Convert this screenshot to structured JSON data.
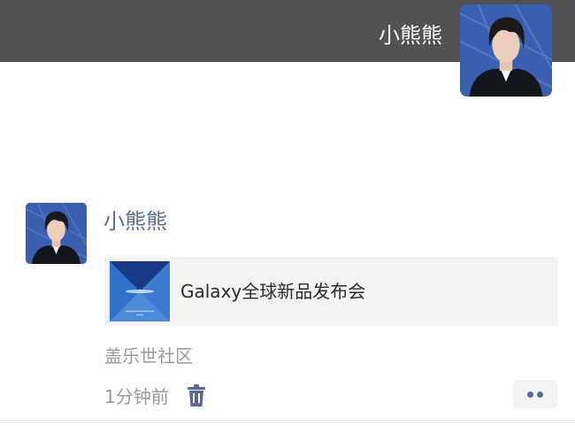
{
  "profile": {
    "name": "小熊熊"
  },
  "post": {
    "author": "小熊熊",
    "link_title": "Galaxy全球新品发布会",
    "source": "盖乐世社区",
    "time": "1分钟前"
  },
  "icons": {
    "delete": "trash-icon",
    "more": "more-dots-icon"
  },
  "colors": {
    "cover": "#525252",
    "author_name": "#576b95",
    "meta_text": "#9a9a9a",
    "card_background": "#f3f3f5"
  }
}
